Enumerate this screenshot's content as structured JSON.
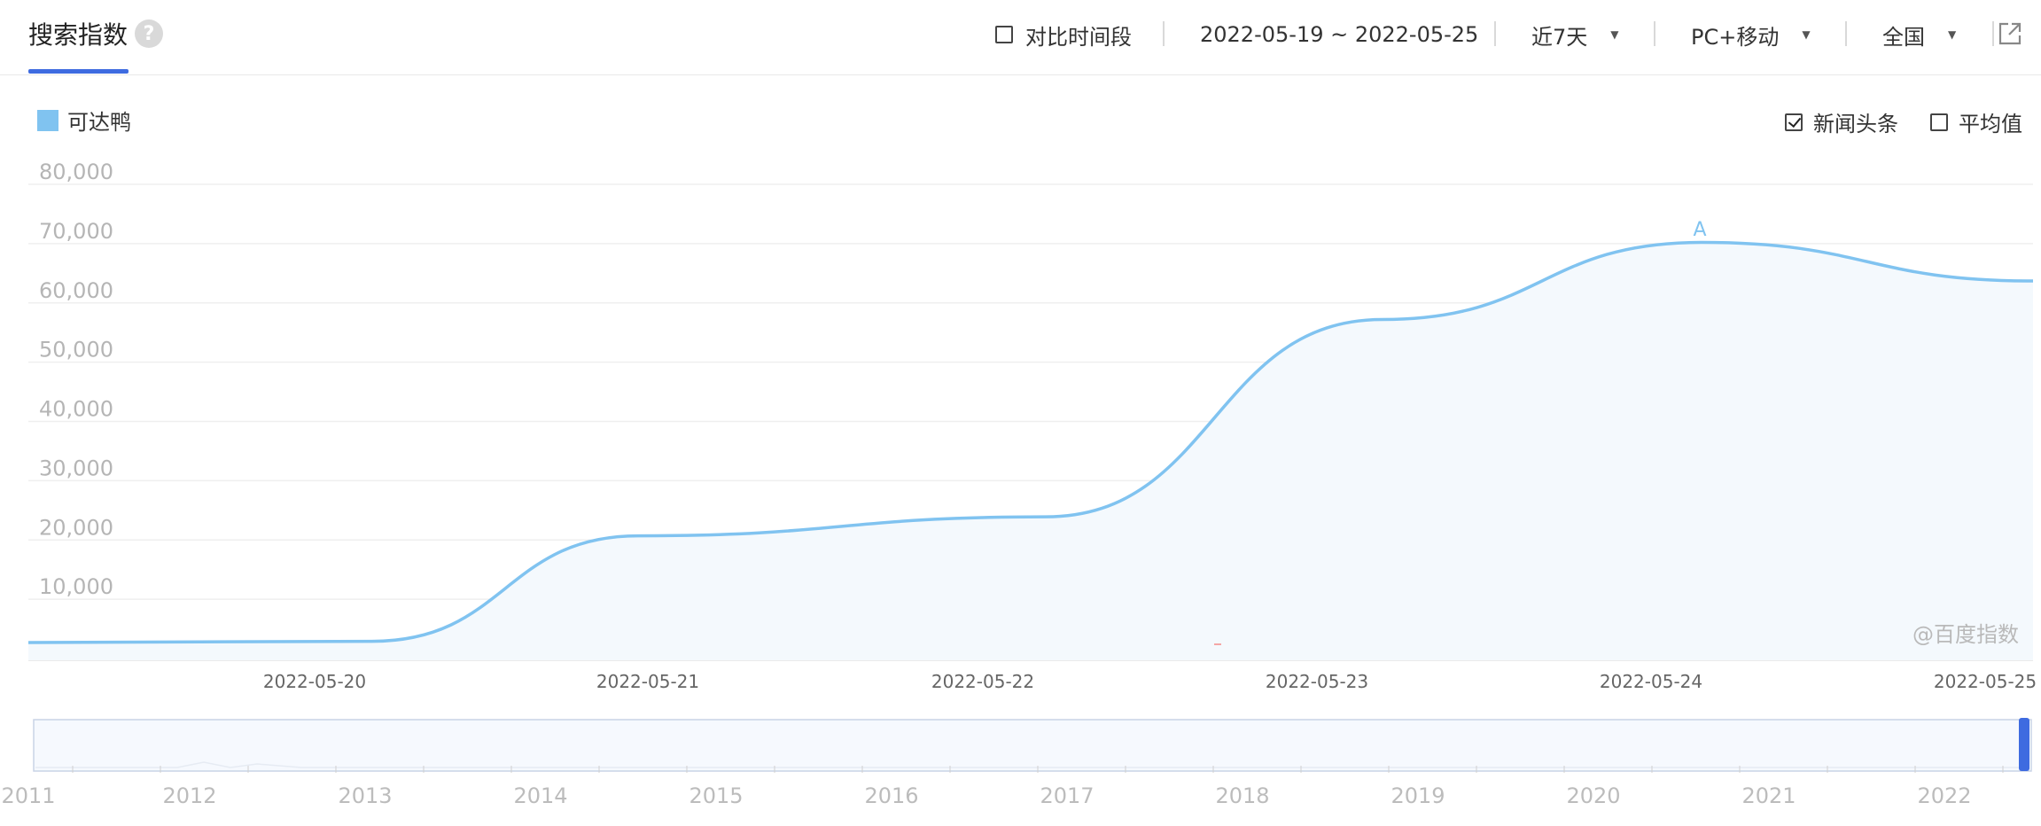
{
  "header": {
    "title": "搜索指数",
    "help_icon": "?",
    "compare_label": "对比时间段",
    "date_range": "2022-05-19 ~ 2022-05-25",
    "period": "近7天",
    "device": "PC+移动",
    "region": "全国",
    "export_icon": "export-icon"
  },
  "legend": {
    "series_name": "可达鸭",
    "color": "#80c3f0"
  },
  "options": {
    "news_label": "新闻头条",
    "news_checked": true,
    "avg_label": "平均值",
    "avg_checked": false
  },
  "watermark": "@百度指数",
  "annotation": "A",
  "chart_data": {
    "type": "area",
    "series": [
      {
        "name": "可达鸭",
        "color": "#80c3f0",
        "x": [
          "2022-05-19",
          "2022-05-20",
          "2022-05-21",
          "2022-05-22",
          "2022-05-23",
          "2022-05-24",
          "2022-05-25"
        ],
        "values": [
          3000,
          3200,
          21000,
          24500,
          57500,
          70500,
          64000
        ]
      }
    ],
    "y_ticks": [
      "10,000",
      "20,000",
      "30,000",
      "40,000",
      "50,000",
      "60,000",
      "70,000",
      "80,000"
    ],
    "x_ticks": [
      "2022-05-20",
      "2022-05-21",
      "2022-05-22",
      "2022-05-23",
      "2022-05-24",
      "2022-05-25"
    ],
    "ylim": [
      0,
      80000
    ],
    "grid": true,
    "annotation": {
      "label": "A",
      "x": "2022-05-24"
    }
  },
  "timeline": {
    "years": [
      "2011",
      "2012",
      "2013",
      "2014",
      "2015",
      "2016",
      "2017",
      "2018",
      "2019",
      "2020",
      "2021",
      "2022"
    ]
  }
}
